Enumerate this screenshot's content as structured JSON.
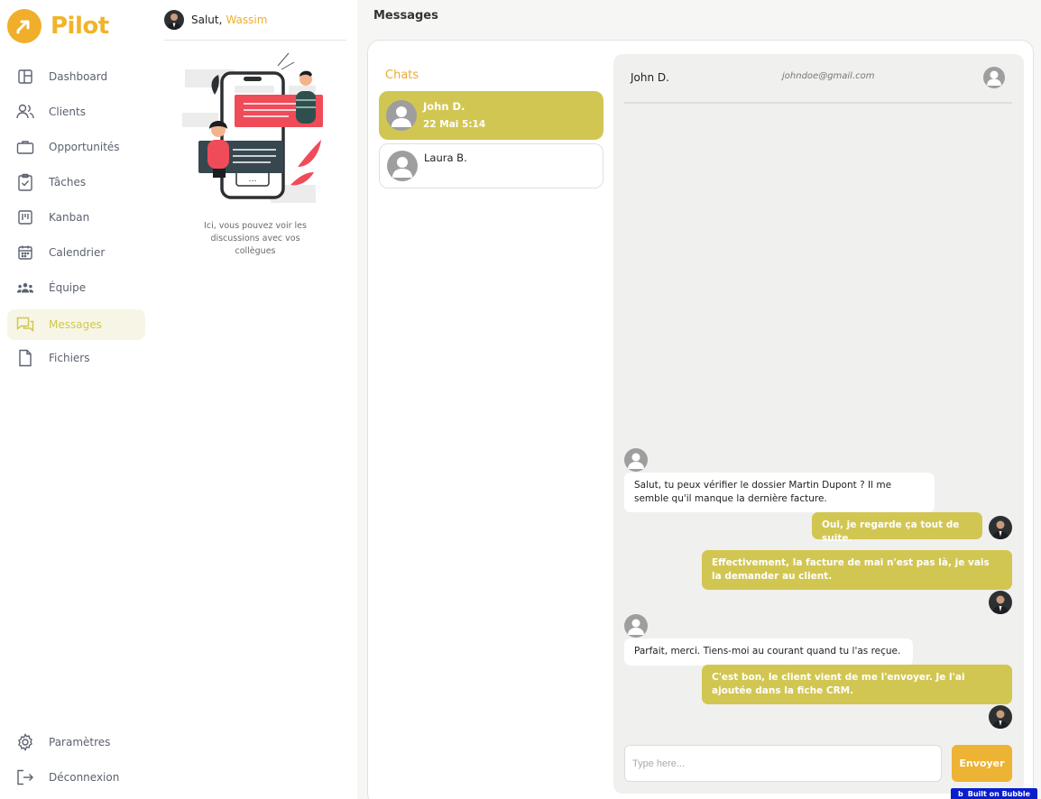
{
  "brand": {
    "name": "Pilot",
    "color": "#f0b429"
  },
  "nav": {
    "items": [
      {
        "label": "Dashboard",
        "icon": "layout-icon"
      },
      {
        "label": "Clients",
        "icon": "users-icon"
      },
      {
        "label": "Opportunités",
        "icon": "briefcase-icon"
      },
      {
        "label": "Tâches",
        "icon": "clipboard-check-icon"
      },
      {
        "label": "Kanban",
        "icon": "kanban-icon"
      },
      {
        "label": "Calendrier",
        "icon": "calendar-icon"
      },
      {
        "label": "Équipe",
        "icon": "team-icon"
      },
      {
        "label": "Messages",
        "icon": "messages-icon",
        "active": true
      },
      {
        "label": "Fichiers",
        "icon": "file-icon"
      }
    ],
    "bottom": [
      {
        "label": "Paramètres",
        "icon": "gear-icon"
      },
      {
        "label": "Déconnexion",
        "icon": "logout-icon"
      }
    ]
  },
  "greeting": {
    "prefix": "Salut,",
    "name": "Wassim"
  },
  "mid": {
    "caption": "Ici, vous pouvez voir les discussions avec vos collègues"
  },
  "page": {
    "title": "Messages"
  },
  "chats": {
    "title": "Chats",
    "items": [
      {
        "name": "John D.",
        "time": "22 Mai 5:14",
        "active": true
      },
      {
        "name": "Laura B.",
        "time": ""
      }
    ]
  },
  "conversation": {
    "name": "John D.",
    "email": "johndoe@gmail.com",
    "messages": [
      {
        "dir": "in",
        "text": "Salut, tu peux vérifier le dossier Martin Dupont ? Il me semble qu'il manque la dernière facture."
      },
      {
        "dir": "out",
        "text": "Oui, je regarde ça tout de suite."
      },
      {
        "dir": "out",
        "text": "Effectivement, la facture de mai n'est pas là, je vais la demander au client."
      },
      {
        "dir": "in",
        "text": "Parfait, merci. Tiens-moi au courant quand tu l'as reçue."
      },
      {
        "dir": "out",
        "text": "C'est bon, le client vient de me l'envoyer. Je l'ai ajoutée dans la fiche CRM."
      }
    ]
  },
  "composer": {
    "placeholder": "Type here...",
    "send_label": "Envoyer"
  },
  "badge": {
    "label": "Built on Bubble",
    "mark": "b"
  },
  "colors": {
    "accent": "#d2c653",
    "orange": "#edb334",
    "badge": "#0a1fcc"
  }
}
